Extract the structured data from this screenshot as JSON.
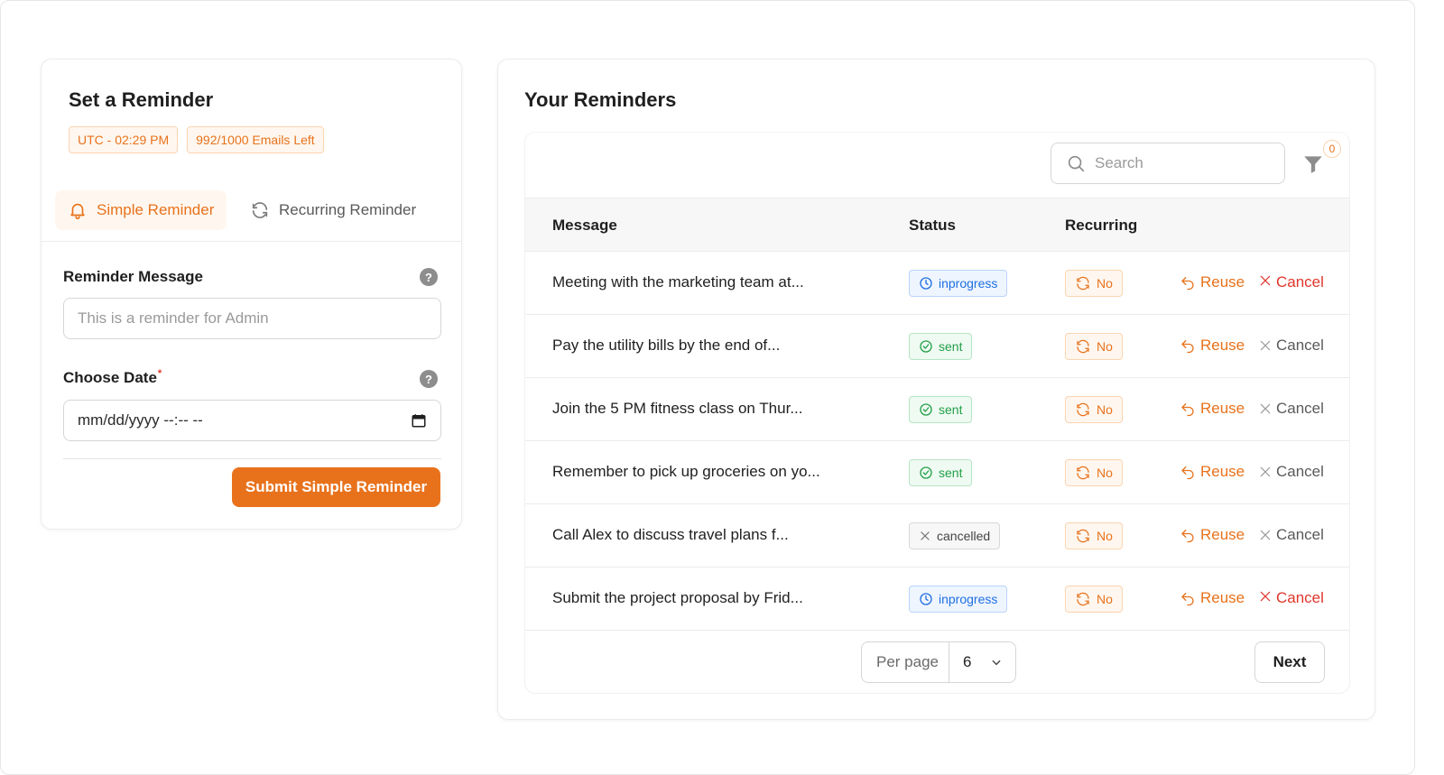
{
  "colors": {
    "accent": "#e8721c",
    "danger": "#e0362b",
    "success": "#23a04a",
    "info": "#1f6fe0"
  },
  "left": {
    "title": "Set a Reminder",
    "tags": [
      "UTC - 02:29 PM",
      "992/1000 Emails Left"
    ],
    "tabs": [
      {
        "label": "Simple Reminder",
        "icon": "bell-icon",
        "active": true
      },
      {
        "label": "Recurring Reminder",
        "icon": "refresh-icon",
        "active": false
      }
    ],
    "message_label": "Reminder Message",
    "message_placeholder": "This is a reminder for Admin",
    "date_label": "Choose Date",
    "date_required_mark": "*",
    "date_placeholder": "mm/dd/yyyy --:-- --",
    "submit_label": "Submit Simple Reminder"
  },
  "right": {
    "title": "Your Reminders",
    "search_placeholder": "Search",
    "filter_count": "0",
    "columns": {
      "message": "Message",
      "status": "Status",
      "recurring": "Recurring"
    },
    "rows": [
      {
        "message": "Meeting with the marketing team at...",
        "status": "inprogress",
        "recurring": "No",
        "reuse": "Reuse",
        "cancel": "Cancel",
        "cancel_enabled": true
      },
      {
        "message": "Pay the utility bills by the end of...",
        "status": "sent",
        "recurring": "No",
        "reuse": "Reuse",
        "cancel": "Cancel",
        "cancel_enabled": false
      },
      {
        "message": "Join the 5 PM fitness class on Thur...",
        "status": "sent",
        "recurring": "No",
        "reuse": "Reuse",
        "cancel": "Cancel",
        "cancel_enabled": false
      },
      {
        "message": "Remember to pick up groceries on yo...",
        "status": "sent",
        "recurring": "No",
        "reuse": "Reuse",
        "cancel": "Cancel",
        "cancel_enabled": false
      },
      {
        "message": "Call Alex to discuss travel plans f...",
        "status": "cancelled",
        "recurring": "No",
        "reuse": "Reuse",
        "cancel": "Cancel",
        "cancel_enabled": false
      },
      {
        "message": "Submit the project proposal by Frid...",
        "status": "inprogress",
        "recurring": "No",
        "reuse": "Reuse",
        "cancel": "Cancel",
        "cancel_enabled": true
      }
    ],
    "per_page_label": "Per page",
    "per_page_value": "6",
    "next_label": "Next"
  }
}
